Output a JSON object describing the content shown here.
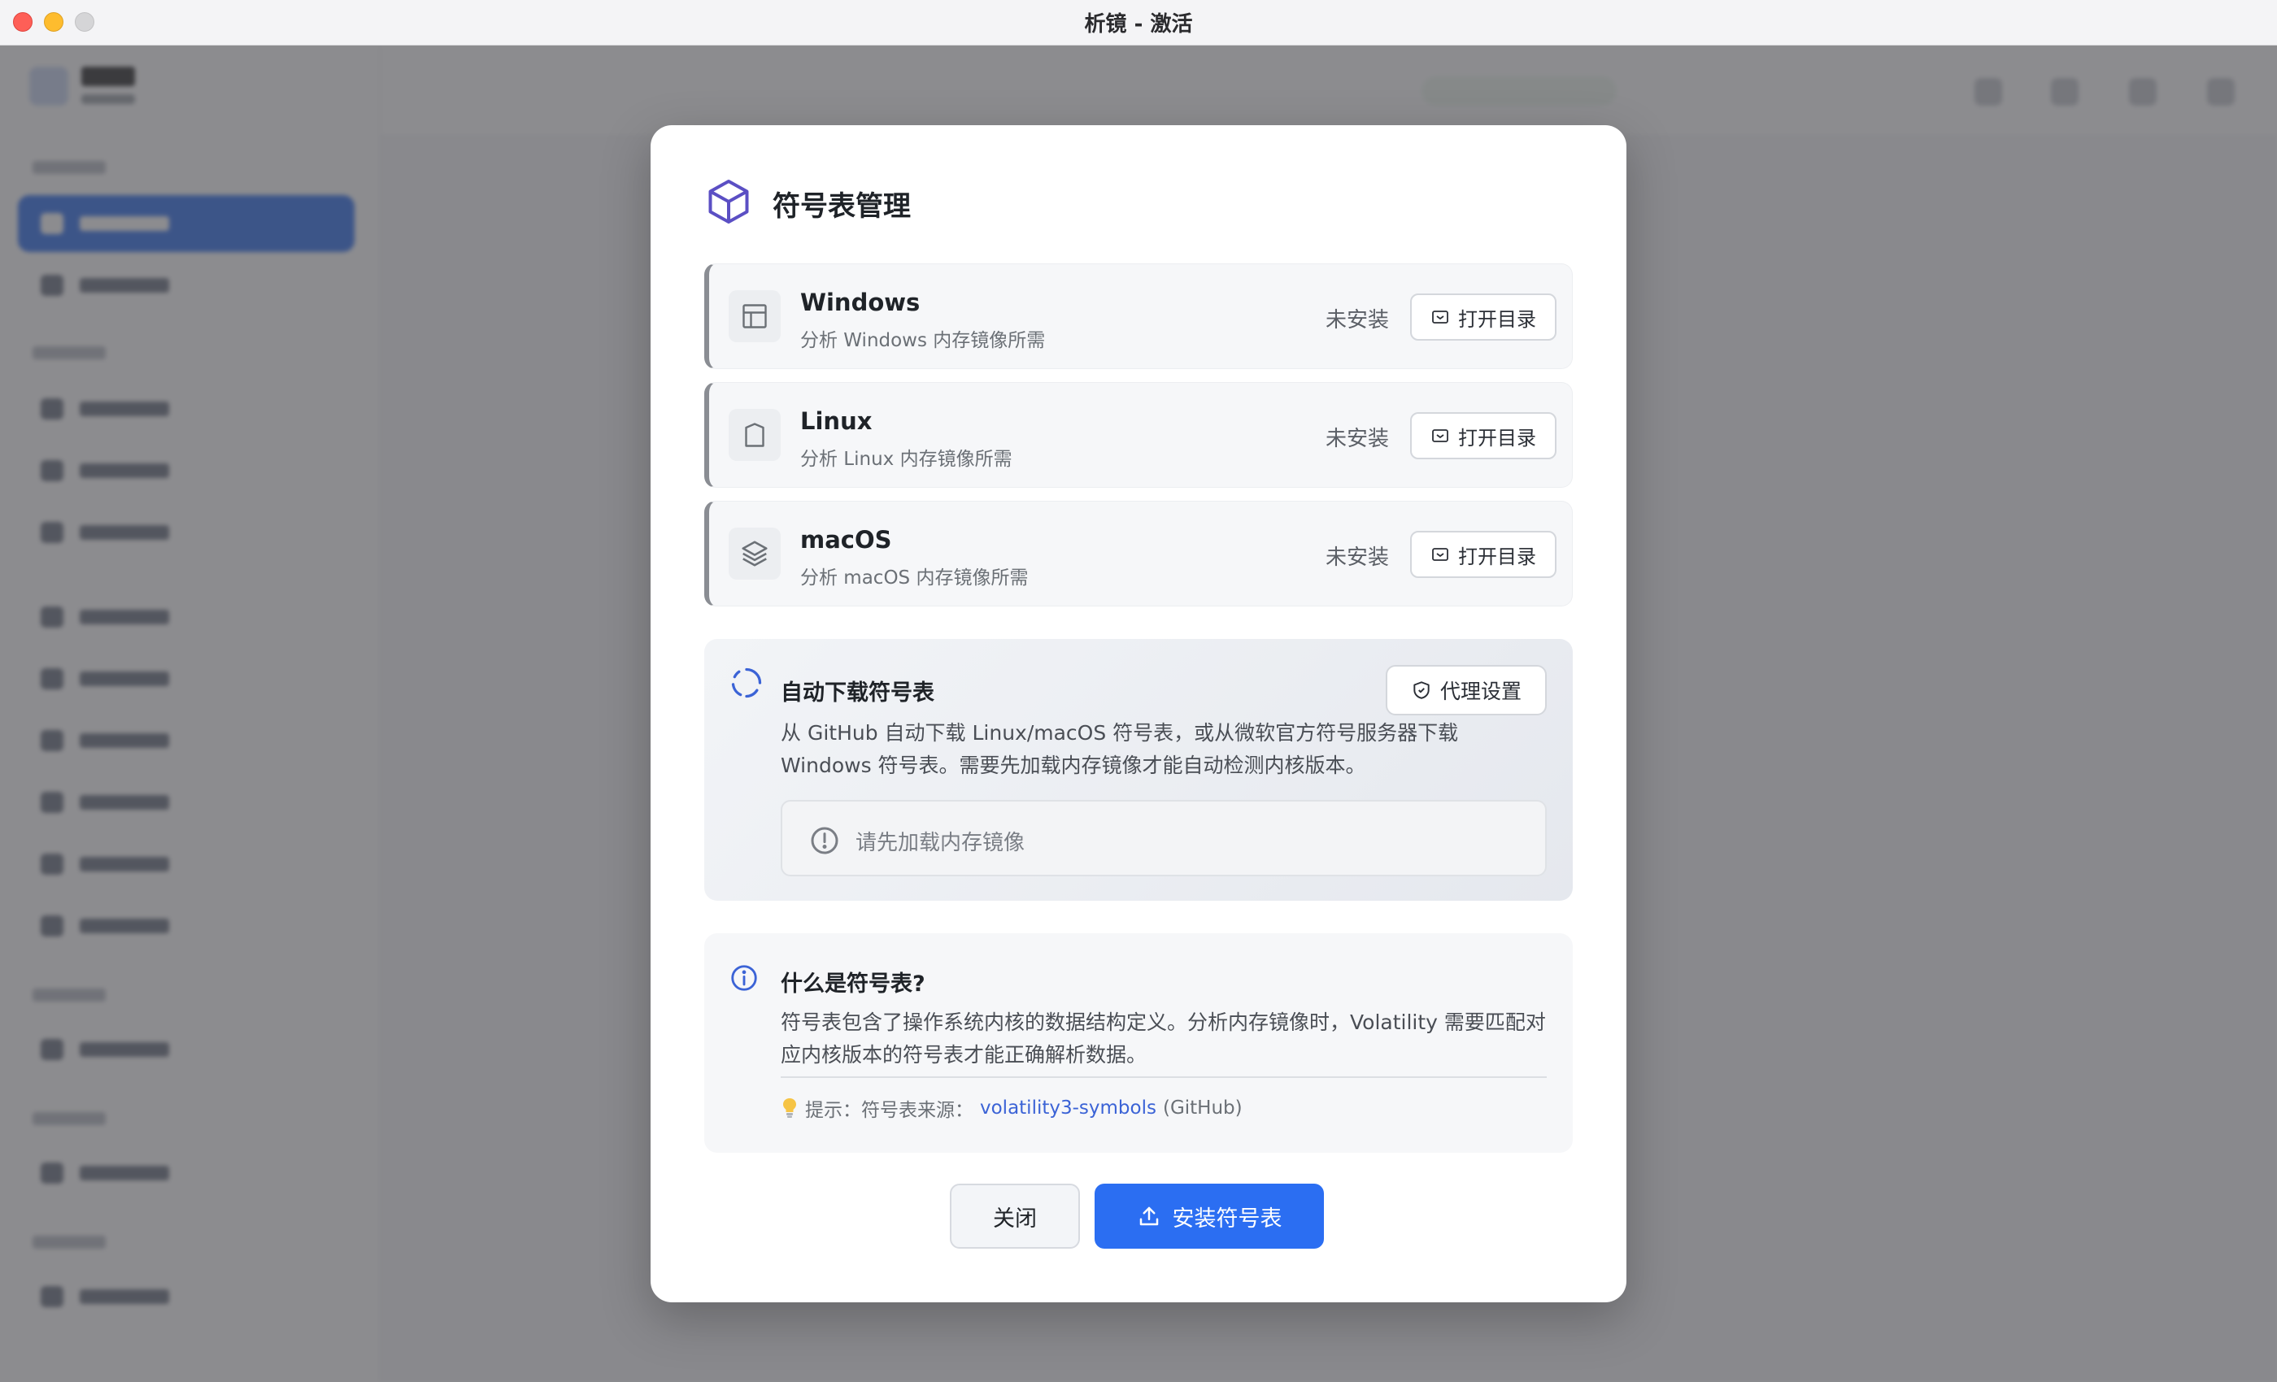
{
  "window": {
    "title": "析镜 - 激活"
  },
  "modal": {
    "title": "符号表管理",
    "os_items": [
      {
        "name": "Windows",
        "desc": "分析 Windows 内存镜像所需",
        "status": "未安装",
        "button": "打开目录",
        "icon": "windows-layout-icon"
      },
      {
        "name": "Linux",
        "desc": "分析 Linux 内存镜像所需",
        "status": "未安装",
        "button": "打开目录",
        "icon": "shield-icon"
      },
      {
        "name": "macOS",
        "desc": "分析 macOS 内存镜像所需",
        "status": "未安装",
        "button": "打开目录",
        "icon": "layers-icon"
      }
    ],
    "auto_download": {
      "title": "自动下载符号表",
      "proxy_button": "代理设置",
      "description": "从 GitHub 自动下载 Linux/macOS 符号表，或从微软官方符号服务器下载 Windows 符号表。需要先加载内存镜像才能自动检测内核版本。",
      "notice": "请先加载内存镜像"
    },
    "info": {
      "title": "什么是符号表?",
      "description": "符号表包含了操作系统内核的数据结构定义。分析内存镜像时，Volatility 需要匹配对应内核版本的符号表才能正确解析数据。",
      "tip_prefix": "提示：符号表来源：",
      "tip_link": "volatility3-symbols",
      "tip_suffix": "(GitHub)"
    },
    "buttons": {
      "close": "关闭",
      "install": "安装符号表"
    }
  },
  "colors": {
    "accent": "#2b6ef2",
    "link": "#3b63d6",
    "brand_icon": "#5b4fc4"
  }
}
